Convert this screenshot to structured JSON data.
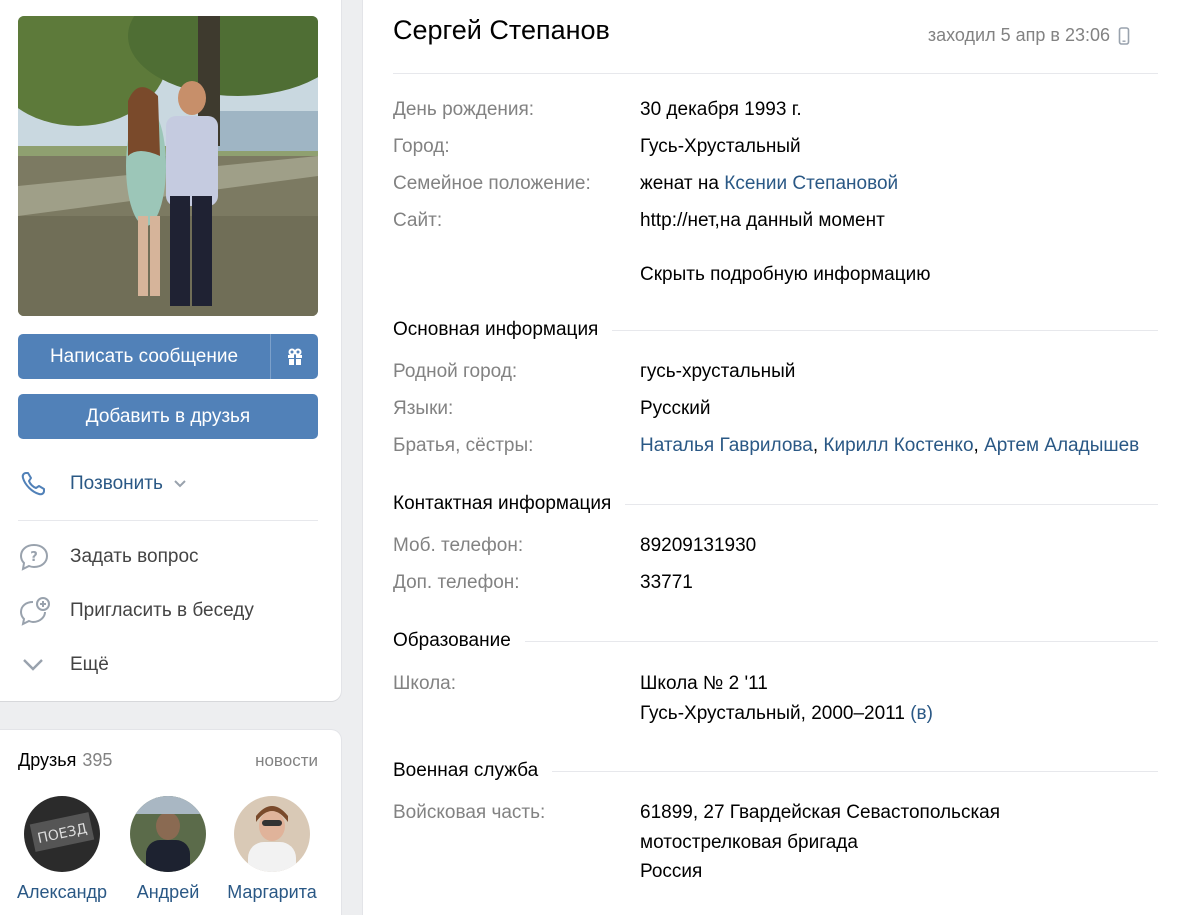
{
  "profile": {
    "name": "Сергей Степанов",
    "last_seen": "заходил 5 апр в 23:06",
    "message_button": "Написать сообщение",
    "add_friend_button": "Добавить в друзья",
    "actions": {
      "call": "Позвонить",
      "ask": "Задать вопрос",
      "invite": "Пригласить в беседу",
      "more": "Ещё"
    }
  },
  "friends": {
    "title": "Друзья",
    "count": "395",
    "news_link": "новости",
    "items": [
      {
        "name": "Александр"
      },
      {
        "name": "Андрей"
      },
      {
        "name": "Маргарита"
      }
    ]
  },
  "info": {
    "birthday": {
      "label": "День рождения:",
      "value": "30 декабря 1993 г."
    },
    "city": {
      "label": "Город:",
      "value": "Гусь-Хрустальный"
    },
    "family": {
      "label": "Семейное положение:",
      "prefix": "женат на ",
      "spouse": "Ксении Степановой"
    },
    "site": {
      "label": "Сайт:",
      "value": "http://нет,на данный момент"
    },
    "hide_link": "Скрыть подробную информацию"
  },
  "sections": {
    "basic": {
      "title": "Основная информация",
      "hometown": {
        "label": "Родной город:",
        "value": "гусь-хрустальный"
      },
      "languages": {
        "label": "Языки:",
        "value": "Русский"
      },
      "siblings": {
        "label": "Братья, сёстры:",
        "values": [
          "Наталья Гаврилова",
          "Кирилл Костенко",
          "Артем Аладышев"
        ],
        "sep": ", "
      }
    },
    "contacts": {
      "title": "Контактная информация",
      "mobile": {
        "label": "Моб. телефон:",
        "value": "89209131930"
      },
      "extra": {
        "label": "Доп. телефон:",
        "value": "33771"
      }
    },
    "education": {
      "title": "Образование",
      "school": {
        "label": "Школа:",
        "name": "Школа № 2 '11",
        "details": "Гусь-Хрустальный, 2000–2011 ",
        "class_link": "(в)"
      }
    },
    "military": {
      "title": "Военная служба",
      "unit": {
        "label": "Войсковая часть:",
        "line1": "61899, 27 Гвардейская Севастопольская",
        "line2": "мотострелковая бригада",
        "country": "Россия"
      }
    }
  },
  "colors": {
    "accent": "#5181b8",
    "link": "#2a5885",
    "muted": "#828282",
    "background": "#edeef0"
  }
}
